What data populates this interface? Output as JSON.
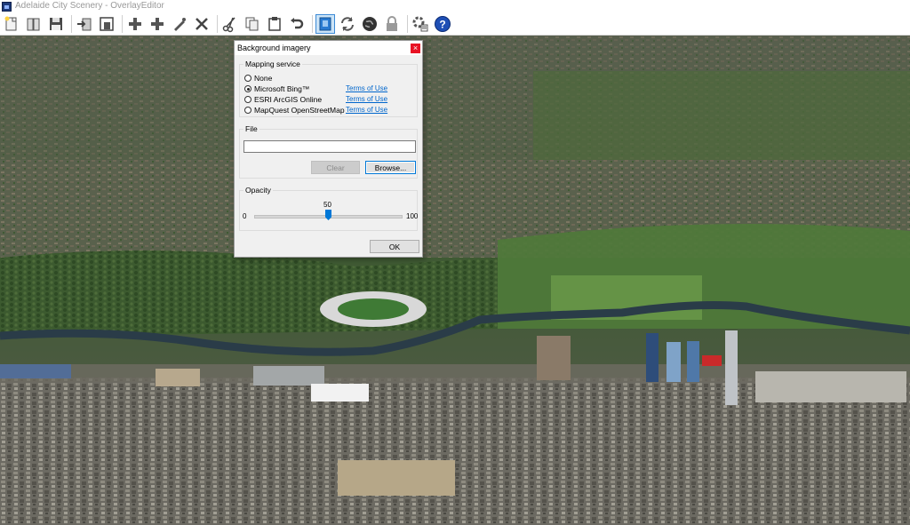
{
  "window": {
    "title": "Adelaide City Scenery - OverlayEditor"
  },
  "toolbar": {
    "buttons": [
      "new-icon",
      "open-icon",
      "save-icon",
      "import-icon",
      "export-icon",
      "add-icon",
      "add-node-icon",
      "draw-icon",
      "delete-icon",
      "cut-icon",
      "copy-icon",
      "paste-icon",
      "undo-icon",
      "background-imagery-icon",
      "reload-icon",
      "globe-icon",
      "lock-icon",
      "preferences-icon",
      "help-icon"
    ],
    "active": "background-imagery-icon"
  },
  "dialog": {
    "title": "Background imagery",
    "close_label": "×",
    "mapping": {
      "label": "Mapping service",
      "options": [
        {
          "label": "None",
          "checked": false,
          "terms": ""
        },
        {
          "label": "Microsoft Bing™",
          "checked": true,
          "terms": "Terms of Use"
        },
        {
          "label": "ESRI ArcGIS Online",
          "checked": false,
          "terms": "Terms of Use"
        },
        {
          "label": "MapQuest OpenStreetMap",
          "checked": false,
          "terms": "Terms of Use"
        }
      ]
    },
    "file": {
      "label": "File",
      "value": "",
      "clear_label": "Clear",
      "browse_label": "Browse..."
    },
    "opacity": {
      "label": "Opacity",
      "min": "0",
      "max": "100",
      "value": "50"
    },
    "ok_label": "OK"
  },
  "colors": {
    "accent": "#0078d7",
    "link": "#0066cc",
    "close": "#e81123"
  }
}
